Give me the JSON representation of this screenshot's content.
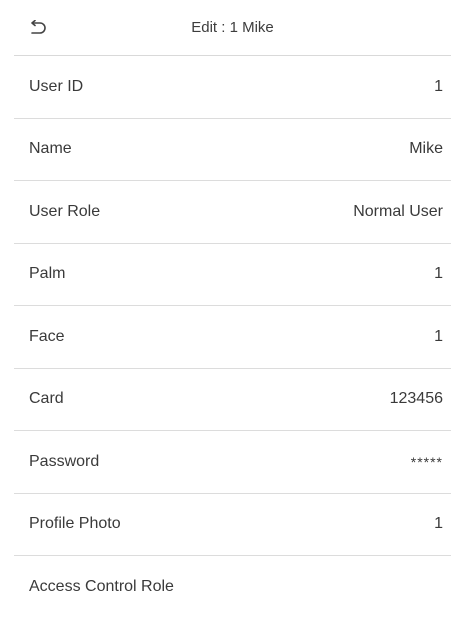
{
  "header": {
    "title": "Edit : 1 Mike",
    "back_icon": "back-arrow-icon"
  },
  "fields": [
    {
      "key": "user_id",
      "label": "User ID",
      "value": "1"
    },
    {
      "key": "name",
      "label": "Name",
      "value": "Mike"
    },
    {
      "key": "user_role",
      "label": "User Role",
      "value": "Normal User"
    },
    {
      "key": "palm",
      "label": "Palm",
      "value": "1"
    },
    {
      "key": "face",
      "label": "Face",
      "value": "1"
    },
    {
      "key": "card",
      "label": "Card",
      "value": "123456"
    },
    {
      "key": "password",
      "label": "Password",
      "value": "*****"
    },
    {
      "key": "profile_photo",
      "label": "Profile Photo",
      "value": "1"
    },
    {
      "key": "access_control_role",
      "label": "Access Control Role",
      "value": ""
    }
  ],
  "colors": {
    "background": "#ffffff",
    "text": "#3a3a3a",
    "divider": "#dcdcdc"
  }
}
